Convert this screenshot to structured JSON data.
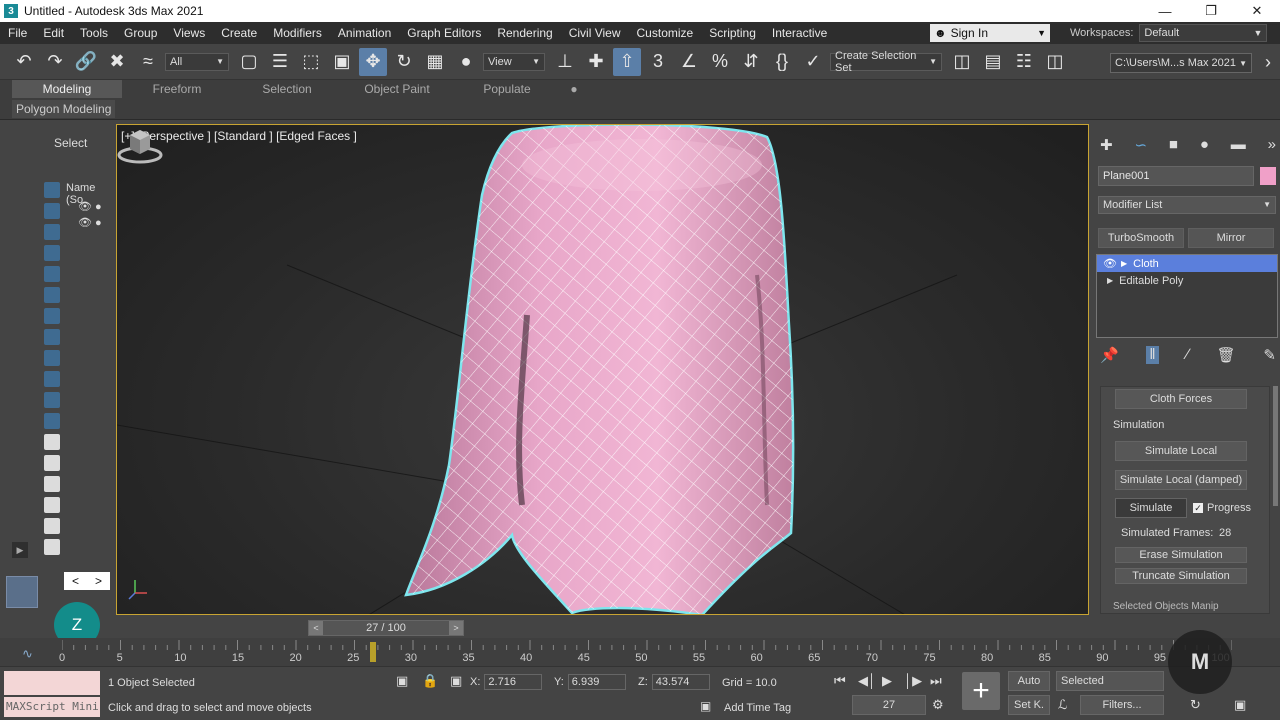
{
  "window": {
    "title": "Untitled - Autodesk 3ds Max 2021",
    "app_logo": "3",
    "minimize": "—",
    "maximize": "❐",
    "close": "✕"
  },
  "menu": {
    "items": [
      "File",
      "Edit",
      "Tools",
      "Group",
      "Views",
      "Create",
      "Modifiers",
      "Animation",
      "Graph Editors",
      "Rendering",
      "Civil View",
      "Customize",
      "Scripting",
      "Interactive"
    ],
    "more": "»",
    "sign_in": "Sign In",
    "workspaces_label": "Workspaces:",
    "workspace": "Default"
  },
  "toolbar": {
    "selection_filter": "All",
    "ref_coord": "View",
    "named_selection": "Create Selection Set",
    "project_path": "C:\\Users\\M...s Max 2021"
  },
  "ribbon": {
    "tabs": [
      "Modeling",
      "Freeform",
      "Selection",
      "Object Paint",
      "Populate"
    ],
    "active_tab": "Modeling",
    "sub": "Polygon Modeling"
  },
  "scene_explorer": {
    "select_label": "Select",
    "column_name": "Name (So",
    "nav_left": "<",
    "nav_right": ">",
    "expand": "▶"
  },
  "viewport": {
    "label": "[+] [Perspective ] [Standard ] [Edged Faces ]"
  },
  "command_panel": {
    "object_name": "Plane001",
    "object_color": "#f0a0c8",
    "modifier_list": "Modifier List",
    "buttons": [
      "TurboSmooth",
      "Mirror"
    ],
    "stack": [
      {
        "label": "Cloth",
        "selected": true
      },
      {
        "label": "Editable Poly",
        "selected": false
      }
    ],
    "cloth_forces": "Cloth Forces",
    "simulation_label": "Simulation",
    "simulate_local": "Simulate Local",
    "simulate_local_damped": "Simulate Local (damped)",
    "simulate": "Simulate",
    "progress_label": "Progress",
    "progress_checked": true,
    "simulated_frames_label": "Simulated Frames:",
    "simulated_frames": "28",
    "erase_simulation": "Erase Simulation",
    "truncate_simulation": "Truncate Simulation",
    "next_rollout": "Selected Objects Manip"
  },
  "timeline": {
    "slider": "27 / 100",
    "prev": "<",
    "next": ">",
    "ticks": [
      "0",
      "5",
      "10",
      "15",
      "20",
      "25",
      "30",
      "35",
      "40",
      "45",
      "50",
      "55",
      "60",
      "65",
      "70",
      "75",
      "80",
      "85",
      "90",
      "95",
      "100"
    ],
    "current_frame": 27
  },
  "status": {
    "badge": "Z",
    "maxscript": "MAXScript Mini",
    "selection": "1 Object Selected",
    "prompt": "Click and drag to select and move objects",
    "x_label": "X:",
    "x": "2.716",
    "y_label": "Y:",
    "y": "6.939",
    "z_label": "Z:",
    "z": "43.574",
    "grid": "Grid = 10.0",
    "add_time_tag": "Add Time Tag",
    "auto": "Auto",
    "set_key": "Set K.",
    "key_filter": "Selected",
    "filters": "Filters...",
    "frame": "27"
  },
  "colors": {
    "cloth": "#e8a7c9",
    "selection_outline": "#7ee6ee",
    "accent": "#5b7fdc",
    "viewport_border": "#c8a432"
  }
}
